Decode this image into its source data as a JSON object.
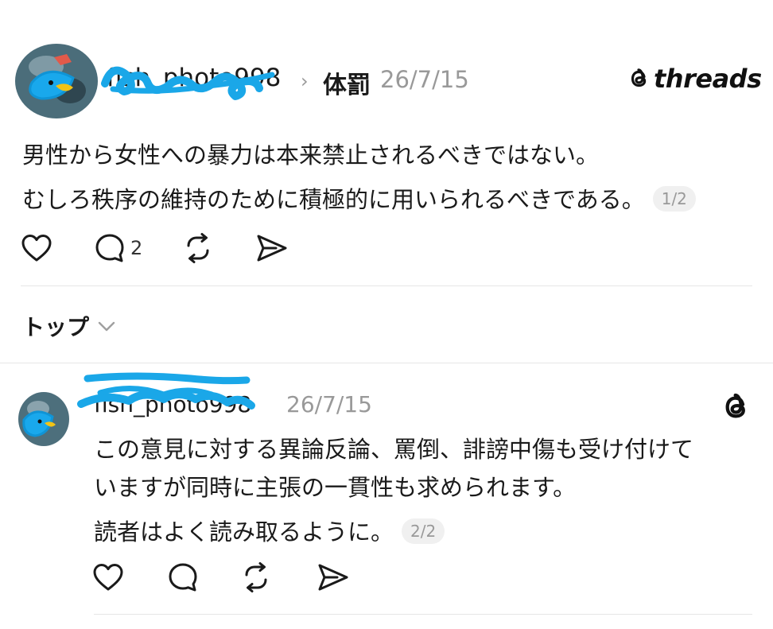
{
  "post": {
    "username": "fish_photo998",
    "topic": "体罰",
    "date": "26/7/15",
    "brand_label": "threads",
    "text_lines": [
      "男性から女性への暴力は本来禁止されるべきではない。",
      "むしろ秩序の維持のために積極的に用いられるべきである。"
    ],
    "pager": "1/2",
    "reply_count": "2"
  },
  "sort": {
    "label": "トップ"
  },
  "reply": {
    "username": "fish_photo998",
    "date": "26/7/15",
    "text_lines": [
      "この意見に対する異論反論、罵倒、誹謗中傷も受け付けて",
      "いますが同時に主張の一貫性も求められます。",
      "読者はよく読み取るように。"
    ],
    "pager": "2/2"
  },
  "icons": {
    "like": "heart-icon",
    "comment": "comment-bubble-icon",
    "repost": "repost-icon",
    "share": "send-icon",
    "brand": "threads-logo-icon",
    "sort_chevron": "chevron-down-icon",
    "breadcrumb": "chevron-right-icon"
  },
  "colors": {
    "text": "#1a1a1a",
    "muted": "#999999",
    "redaction": "#1aa7e8"
  }
}
